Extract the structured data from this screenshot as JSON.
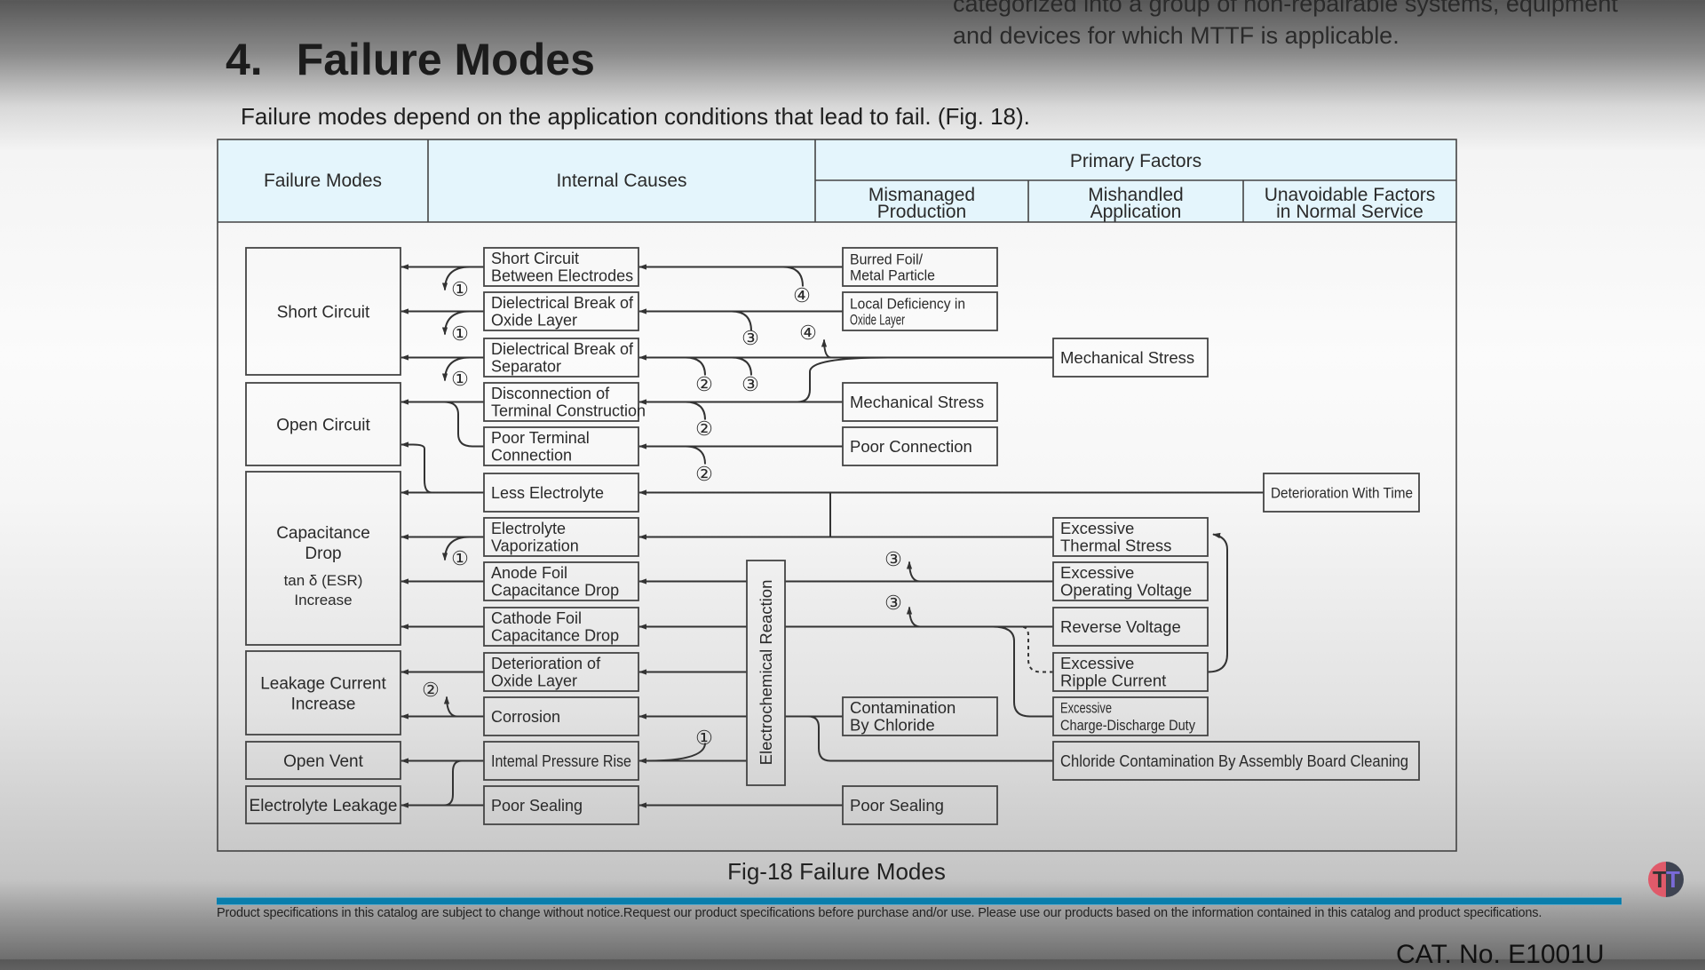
{
  "page": {
    "top_text_lines": [
      "categorized into a group of non-repairable systems, equipment",
      "and devices for which MTTF is applicable."
    ],
    "section_number": "4.",
    "section_title": "Failure Modes",
    "intro": "Failure modes depend on the application conditions that lead to fail. (Fig. 18).",
    "caption": "Fig-18 Failure Modes",
    "disclaimer": "Product specifications in this catalog are subject to change without notice.Request our product specifications before purchase and/or use. Please use our products based on the information contained in this catalog and product specifications.",
    "catalog_number": "CAT. No. E1001U",
    "accent_color": "#0a7eac",
    "header_fill": "#e4f5fc",
    "logo": {
      "icon": "tt-channel-logo",
      "letters": [
        "T",
        "T"
      ]
    }
  },
  "table_header": {
    "failure_modes": "Failure Modes",
    "internal_causes": "Internal Causes",
    "primary_factors": "Primary Factors",
    "mismanaged": [
      "Mismanaged",
      "Production"
    ],
    "mishandled": [
      "Mishandled",
      "Application"
    ],
    "unavoidable": [
      "Unavoidable Factors",
      "in Normal Service"
    ]
  },
  "failure_modes": [
    {
      "id": "short",
      "lines": [
        "Short Circuit"
      ]
    },
    {
      "id": "open",
      "lines": [
        "Open Circuit"
      ]
    },
    {
      "id": "cap",
      "lines": [
        "Capacitance",
        "Drop"
      ],
      "sub_lines": [
        "tan δ (ESR)",
        "Increase"
      ]
    },
    {
      "id": "leak",
      "lines": [
        "Leakage Current",
        "Increase"
      ]
    },
    {
      "id": "vent",
      "lines": [
        "Open Vent"
      ]
    },
    {
      "id": "elleak",
      "lines": [
        "Electrolyte Leakage"
      ]
    }
  ],
  "internal_causes": [
    {
      "lines": [
        "Short Circuit",
        "Between Electrodes"
      ]
    },
    {
      "lines": [
        "Dielectrical Break of",
        "Oxide Layer"
      ]
    },
    {
      "lines": [
        "Dielectrical Break of",
        "Separator"
      ]
    },
    {
      "lines": [
        "Disconnection of",
        "Terminal Construction"
      ]
    },
    {
      "lines": [
        "Poor Terminal",
        "Connection"
      ]
    },
    {
      "lines": [
        "Less Electrolyte"
      ]
    },
    {
      "lines": [
        "Electrolyte",
        "Vaporization"
      ]
    },
    {
      "lines": [
        "Anode Foil",
        "Capacitance Drop"
      ]
    },
    {
      "lines": [
        "Cathode Foil",
        "Capacitance Drop"
      ]
    },
    {
      "lines": [
        "Deterioration of",
        "Oxide Layer"
      ]
    },
    {
      "lines": [
        "Corrosion"
      ]
    },
    {
      "lines": [
        "Intemal Pressure Rise"
      ]
    },
    {
      "lines": [
        "Poor Sealing"
      ]
    }
  ],
  "intermediate": {
    "electrochemical_reaction": "Electrochemical Reaction"
  },
  "mismanaged_production": [
    {
      "row": 0,
      "lines": [
        "Burred Foil/",
        "Metal Particle"
      ]
    },
    {
      "row": 1,
      "lines": [
        "Local Deficiency in",
        "Oxide Layer"
      ]
    },
    {
      "row": 3,
      "lines": [
        "Mechanical Stress"
      ]
    },
    {
      "row": 4,
      "lines": [
        "Poor Connection"
      ]
    },
    {
      "row": 10,
      "lines": [
        "Contamination",
        "By Chloride"
      ]
    },
    {
      "row": 12,
      "lines": [
        "Poor Sealing"
      ]
    }
  ],
  "mishandled_application": [
    {
      "row": 2,
      "lines": [
        "Mechanical Stress"
      ]
    },
    {
      "row": 6,
      "lines": [
        "Excessive",
        "Thermal Stress"
      ]
    },
    {
      "row": 7,
      "lines": [
        "Excessive",
        "Operating Voltage"
      ]
    },
    {
      "row": 8,
      "lines": [
        "Reverse Voltage"
      ]
    },
    {
      "row": 9,
      "lines": [
        "Excessive",
        "Ripple Current"
      ]
    },
    {
      "row": 10,
      "lines": [
        "Excessive",
        "Charge-Discharge Duty"
      ]
    },
    {
      "row": 11,
      "lines": [
        "Chloride Contamination By Assembly Board Cleaning"
      ]
    }
  ],
  "unavoidable_factors": [
    {
      "row": 5,
      "lines": [
        "Deterioration With Time"
      ]
    }
  ],
  "circled_markers": {
    "one": "①",
    "two": "②",
    "three": "③",
    "four": "④"
  }
}
